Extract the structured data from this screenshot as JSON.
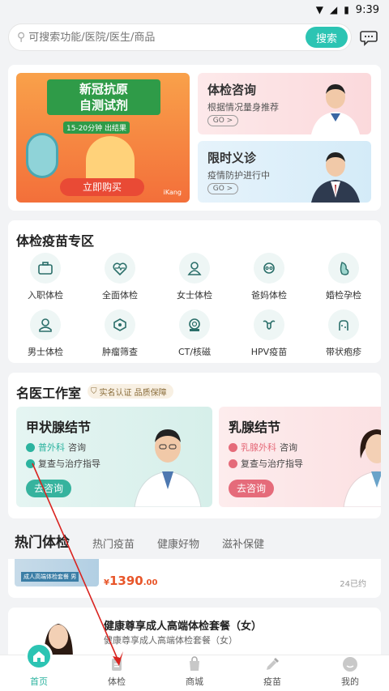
{
  "status": {
    "time": "9:39"
  },
  "search": {
    "placeholder": "可搜索功能/医院/医生/商品",
    "button_label": "搜索"
  },
  "banner": {
    "promo": {
      "title_line1": "新冠抗原",
      "title_line2": "自测试剂",
      "tag": "15-20分钟 出结果",
      "button_label": "立即购买",
      "brand": "iKang"
    },
    "cards": [
      {
        "title": "体检咨询",
        "subtitle": "根据情况量身推荐",
        "go": "GO >"
      },
      {
        "title": "限时义诊",
        "subtitle": "疫情防护进行中",
        "go": "GO >"
      }
    ]
  },
  "zone": {
    "title": "体检疫苗专区",
    "items": [
      {
        "label": "入职体检",
        "icon": "briefcase-icon"
      },
      {
        "label": "全面体检",
        "icon": "heart-pulse-icon"
      },
      {
        "label": "女士体检",
        "icon": "woman-icon"
      },
      {
        "label": "爸妈体检",
        "icon": "elder-icon"
      },
      {
        "label": "婚检孕检",
        "icon": "pregnancy-icon"
      },
      {
        "label": "男士体检",
        "icon": "man-icon"
      },
      {
        "label": "肿瘤筛查",
        "icon": "tumor-icon"
      },
      {
        "label": "CT/核磁",
        "icon": "ct-scanner-icon"
      },
      {
        "label": "HPV疫苗",
        "icon": "uterus-icon"
      },
      {
        "label": "带状疱疹",
        "icon": "shingles-icon"
      }
    ]
  },
  "famous": {
    "title": "名医工作室",
    "badge": "实名认证 品质保障",
    "cards": [
      {
        "title": "甲状腺结节",
        "line1_highlight": "普外科",
        "line1_rest": "咨询",
        "line2": "复查与治疗指导",
        "button_label": "去咨询"
      },
      {
        "title": "乳腺结节",
        "line1_highlight": "乳腺外科",
        "line1_rest": "咨询",
        "line2": "复查与治疗指导",
        "button_label": "去咨询"
      }
    ]
  },
  "tabs": [
    "热门体检",
    "热门疫苗",
    "健康好物",
    "滋补保健"
  ],
  "products": [
    {
      "thumb_caption": "成人高端体检套餐 男",
      "price_symbol": "¥",
      "price_int": "1390",
      "price_dec": ".00",
      "sold": "24已约"
    },
    {
      "name": "健康尊享成人高端体检套餐（女）",
      "subtitle": "健康尊享成人高端体检套餐（女）"
    }
  ],
  "nav": [
    {
      "label": "首页",
      "icon": "home-icon",
      "active": true
    },
    {
      "label": "体检",
      "icon": "clipboard-icon",
      "active": false
    },
    {
      "label": "商城",
      "icon": "shopping-bag-icon",
      "active": false
    },
    {
      "label": "疫苗",
      "icon": "syringe-icon",
      "active": false
    },
    {
      "label": "我的",
      "icon": "profile-icon",
      "active": false
    }
  ],
  "colors": {
    "accent": "#2cc4b3",
    "price": "#e8562a",
    "annotation_arrow": "#d9231f"
  }
}
